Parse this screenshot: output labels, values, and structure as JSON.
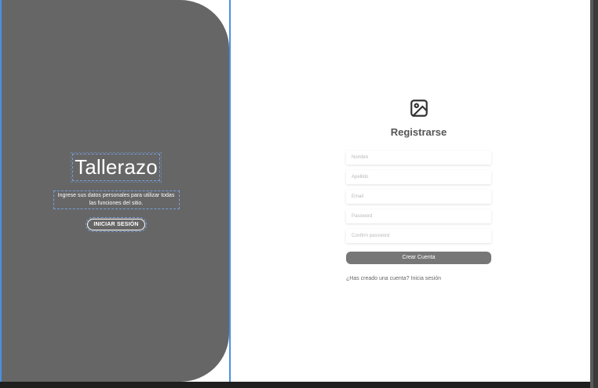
{
  "left": {
    "brand": "Tallerazo",
    "subtitle": "Ingrese sus datos personales para utilizar todas las funciones del sitio.",
    "login_button": "INICIAR SESIÓN"
  },
  "form": {
    "icon": "image-icon",
    "title": "Registrarse",
    "fields": [
      {
        "placeholder": "Nombre"
      },
      {
        "placeholder": "Apellido"
      },
      {
        "placeholder": "Email"
      },
      {
        "placeholder": "Password"
      },
      {
        "placeholder": "Confirm password"
      }
    ],
    "submit_button": "Crear Cuenta",
    "footer": "¿Has creado una cuenta? Inicia sesión"
  },
  "colors": {
    "left_panel": "#666666",
    "accent": "#4a90e2",
    "button": "#777777"
  }
}
